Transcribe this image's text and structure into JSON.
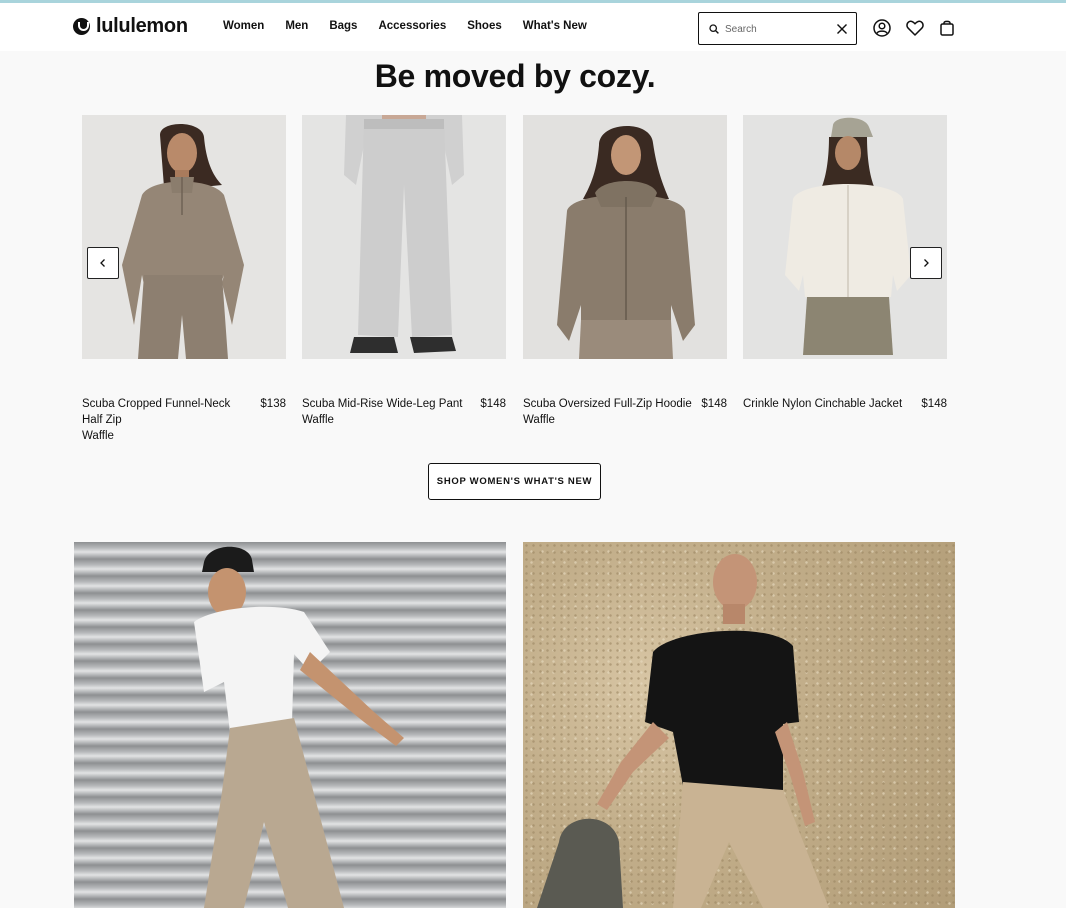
{
  "header": {
    "logo_text": "lululemon",
    "nav": [
      "Women",
      "Men",
      "Bags",
      "Accessories",
      "Shoes",
      "What's New"
    ],
    "search": {
      "placeholder": "Search",
      "value": ""
    },
    "icons": [
      "search-icon",
      "clear-icon",
      "account-icon",
      "wishlist-heart-icon",
      "shopping-bag-icon"
    ]
  },
  "main": {
    "heading": "Be moved by cozy.",
    "products": [
      {
        "name": "Scuba Cropped Funnel-Neck Half Zip",
        "color": "Waffle",
        "price": "$138"
      },
      {
        "name": "Scuba Mid-Rise Wide-Leg Pant",
        "color": "Waffle",
        "price": "$148"
      },
      {
        "name": "Scuba Oversized Full-Zip Hoodie",
        "color": "Waffle",
        "price": "$148"
      },
      {
        "name": "Crinkle Nylon Cinchable Jacket",
        "color": "",
        "price": "$148"
      }
    ],
    "cta": "SHOP WOMEN'S WHAT'S NEW"
  },
  "colors": {
    "accent_line": "#a9d4dc",
    "page_bg": "#f9f9f9",
    "text": "#111111"
  }
}
